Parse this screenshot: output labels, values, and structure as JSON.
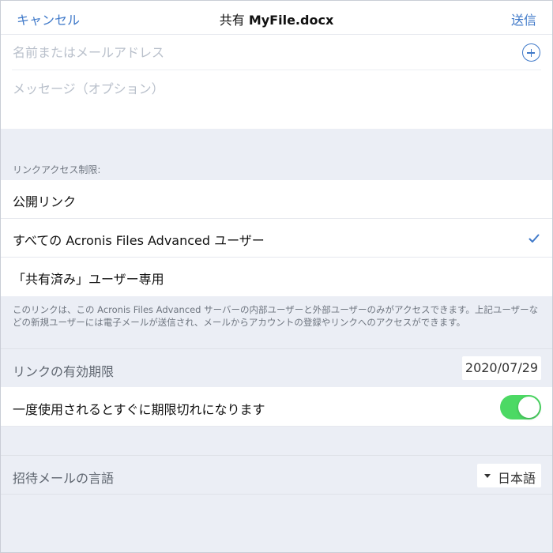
{
  "header": {
    "cancel_label": "キャンセル",
    "title_prefix": "共有",
    "file_name": "MyFile.docx",
    "send_label": "送信"
  },
  "compose": {
    "name_placeholder": "名前またはメールアドレス",
    "add_icon": "plus-circle-icon",
    "message_placeholder": "メッセージ（オプション）"
  },
  "link_access": {
    "section_label": "リンクアクセス制限:",
    "options": [
      {
        "label": "公開リンク",
        "selected": false
      },
      {
        "label": "すべての Acronis Files Advanced ユーザー",
        "selected": true
      },
      {
        "label": "「共有済み」ユーザー専用",
        "selected": false
      }
    ],
    "description": "このリンクは、この Acronis Files Advanced サーバーの内部ユーザーと外部ユーザーのみがアクセスできます。上記ユーザーなどの新規ユーザーには電子メールが送信され、メールからアカウントの登録やリンクへのアクセスができます。"
  },
  "expiry": {
    "label": "リンクの有効期限",
    "date": "2020/07/29"
  },
  "expire_once": {
    "label": "一度使用されるとすぐに期限切れになります",
    "enabled": true
  },
  "language": {
    "label": "招待メールの言語",
    "value": "日本語"
  },
  "colors": {
    "accent": "#3f79c9",
    "toggle_on": "#4cd964",
    "background": "#ebeef5"
  }
}
